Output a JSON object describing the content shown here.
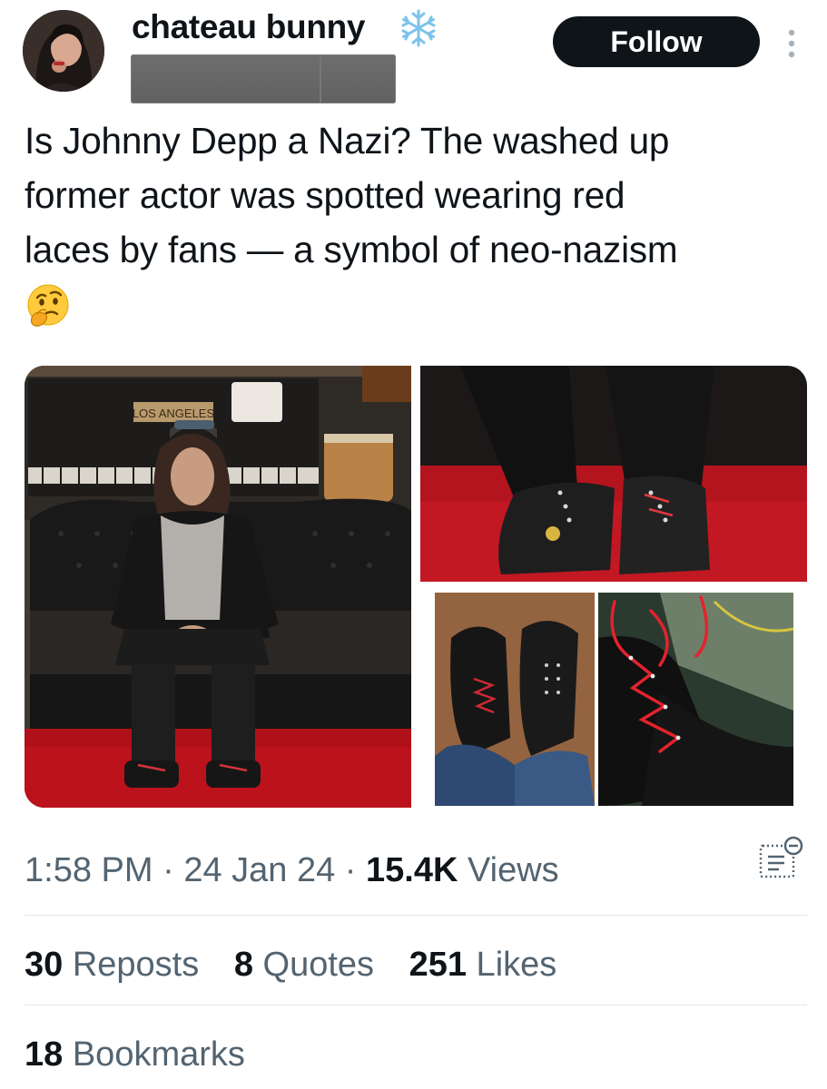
{
  "user": {
    "display_name": "chateau bunny",
    "name_emoji_icon": "snowflake-icon",
    "handle_redacted": true,
    "follow_label": "Follow"
  },
  "tweet": {
    "text": "Is Johnny Depp a Nazi? The washed up\nformer actor was spotted wearing red\nlaces by fans — a symbol of neo-nazism",
    "trailing_emoji": "thinking-face-icon",
    "media_sign_text": "LOS ANGELES"
  },
  "meta": {
    "time": "1:58 PM",
    "sep1": " · ",
    "date": "24 Jan 24",
    "sep2": " · ",
    "views_count": "15.4K",
    "views_label": " Views"
  },
  "stats": {
    "reposts_count": "30",
    "reposts_label": " Reposts",
    "quotes_count": "8",
    "quotes_label": " Quotes",
    "likes_count": "251",
    "likes_label": " Likes",
    "bookmarks_count": "18",
    "bookmarks_label": " Bookmarks"
  },
  "colors": {
    "follow_button": "#0f1419",
    "secondary_text": "#536471",
    "primary_text": "#0f1419",
    "divider": "#e3e6ea"
  }
}
